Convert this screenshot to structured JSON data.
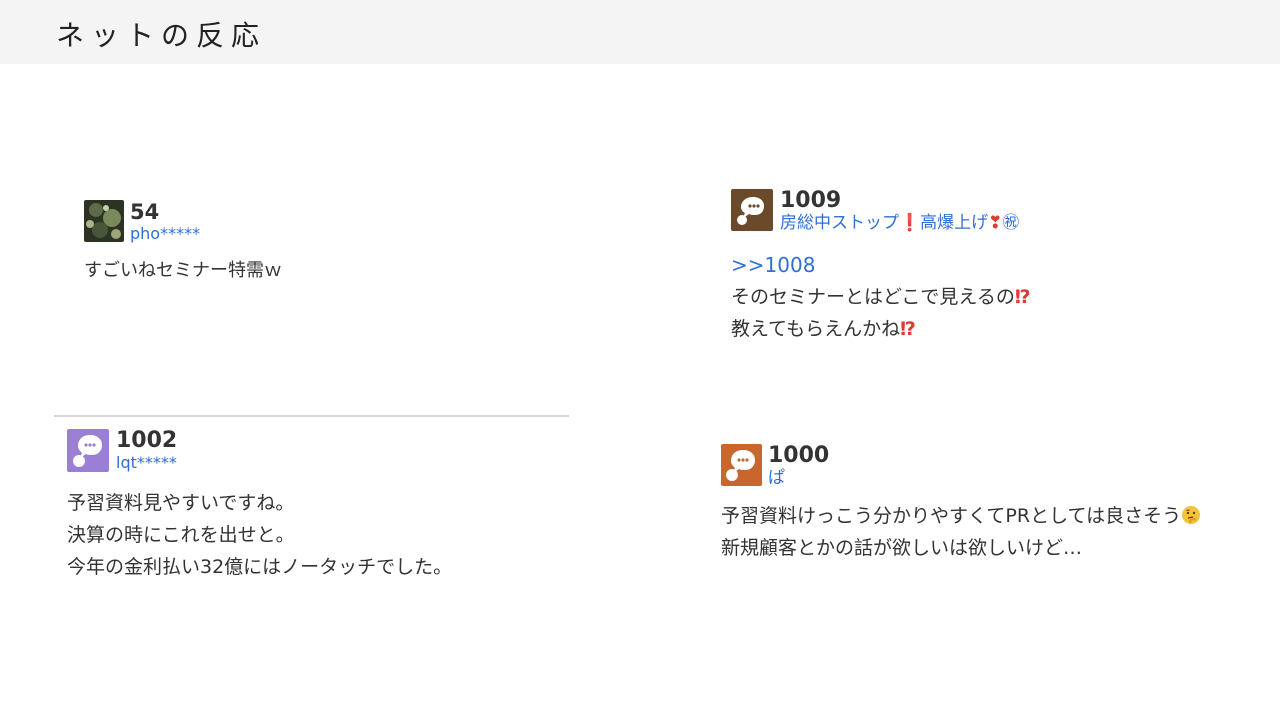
{
  "header": {
    "title": "ネットの反応"
  },
  "posts": [
    {
      "number": "54",
      "user": "pho*****",
      "lines": [
        "すごいねセミナー特需ｗ"
      ]
    },
    {
      "number": "1009",
      "user": "房総中ストップ",
      "user_suffix_1": "❗",
      "user_mid": "高爆上げ",
      "user_suffix_2": "❣",
      "user_suffix_3": "㊗",
      "reply": ">>1008",
      "line1": "そのセミナーとはどこで見えるの",
      "line2": "教えてもらえんかね",
      "emphasis": "⁉"
    },
    {
      "number": "1002",
      "user": "lqt*****",
      "lines": [
        "予習資料見やすいですね。",
        "決算の時にこれを出せと。",
        "今年の金利払い32億にはノータッチでした。"
      ]
    },
    {
      "number": "1000",
      "user": "ぱ",
      "line1": "予習資料けっこう分かりやすくてPRとしては良さそう",
      "line2": "新規顧客とかの話が欲しいは欲しいけど…",
      "emoji": "thinking-face"
    }
  ],
  "colors": {
    "link": "#2f6fd6",
    "avatar_brown": "#6b4a2b",
    "avatar_purple": "#9b7fd4",
    "avatar_orange": "#c8662e",
    "emphasis_red": "#e03b30"
  }
}
